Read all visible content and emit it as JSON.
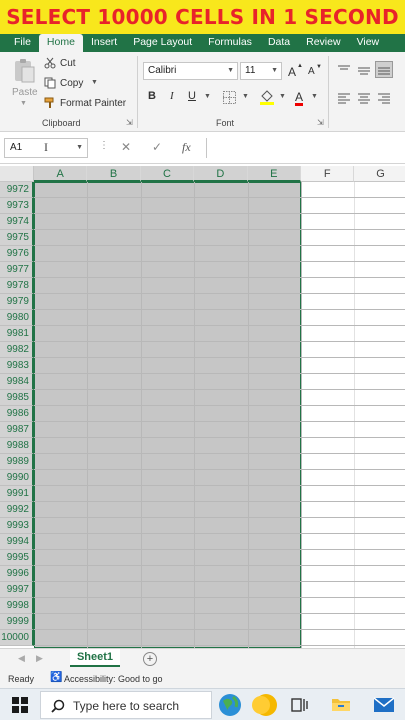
{
  "banner": {
    "text": "SELECT 10000 CELLS IN 1 SECOND"
  },
  "ribbon_tabs": [
    "File",
    "Home",
    "Insert",
    "Page Layout",
    "Formulas",
    "Data",
    "Review",
    "View"
  ],
  "active_tab": "Home",
  "clipboard": {
    "paste_label": "Paste",
    "cut_label": "Cut",
    "copy_label": "Copy",
    "format_painter_label": "Format Painter",
    "group_label": "Clipboard"
  },
  "font": {
    "font_name": "Calibri",
    "font_size": "11",
    "group_label": "Font",
    "bold": "B",
    "italic": "I",
    "underline": "U",
    "font_color_letter": "A",
    "grow_letter": "A",
    "shrink_letter": "A"
  },
  "formula_bar": {
    "name_box": "A1",
    "fx": "fx",
    "value": ""
  },
  "columns": [
    "A",
    "B",
    "C",
    "D",
    "E",
    "F",
    "G"
  ],
  "selected_columns": [
    "A",
    "B",
    "C",
    "D",
    "E"
  ],
  "rows": [
    "9972",
    "9973",
    "9974",
    "9975",
    "9976",
    "9977",
    "9978",
    "9979",
    "9980",
    "9981",
    "9982",
    "9983",
    "9984",
    "9985",
    "9986",
    "9987",
    "9988",
    "9989",
    "9990",
    "9991",
    "9992",
    "9993",
    "9994",
    "9995",
    "9996",
    "9997",
    "9998",
    "9999",
    "10000"
  ],
  "sheet_tab": "Sheet1",
  "status": {
    "ready": "Ready",
    "accessibility": "Accessibility: Good to go"
  },
  "taskbar": {
    "search_placeholder": "Type here to search"
  },
  "colors": {
    "excel_green": "#217346",
    "banner_bg": "#f8e71c",
    "banner_text": "#e8232a",
    "selection": "#c6c6c6"
  }
}
